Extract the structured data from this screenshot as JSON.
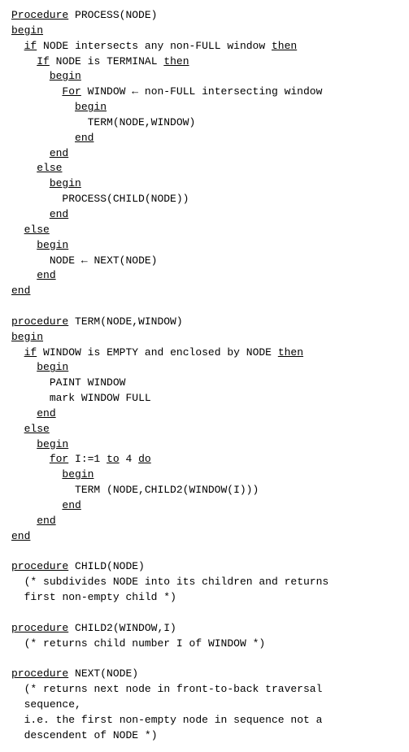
{
  "code": {
    "lines": [
      {
        "id": 1,
        "text": "Procedure PROCESS(NODE)",
        "underline_words": [
          "Procedure"
        ]
      },
      {
        "id": 2,
        "text": "begin",
        "underline_words": [
          "begin"
        ]
      },
      {
        "id": 3,
        "text": "  if NODE intersects any non-FULL window then",
        "underline_words": [
          "if",
          "then"
        ]
      },
      {
        "id": 4,
        "text": "    If NODE is TERMINAL then",
        "underline_words": [
          "If"
        ]
      },
      {
        "id": 5,
        "text": "      begin",
        "underline_words": [
          "begin"
        ]
      },
      {
        "id": 6,
        "text": "        For WINDOW ← non-FULL intersecting window",
        "underline_words": [
          "For"
        ]
      },
      {
        "id": 7,
        "text": "          begin",
        "underline_words": [
          "begin"
        ]
      },
      {
        "id": 8,
        "text": "            TERM(NODE,WINDOW)",
        "underline_words": []
      },
      {
        "id": 9,
        "text": "          end",
        "underline_words": [
          "end"
        ]
      },
      {
        "id": 10,
        "text": "      end",
        "underline_words": [
          "end"
        ]
      },
      {
        "id": 11,
        "text": "    else",
        "underline_words": [
          "else"
        ]
      },
      {
        "id": 12,
        "text": "      begin",
        "underline_words": [
          "begin"
        ]
      },
      {
        "id": 13,
        "text": "        PROCESS(CHILD(NODE))",
        "underline_words": []
      },
      {
        "id": 14,
        "text": "      end",
        "underline_words": [
          "end"
        ]
      },
      {
        "id": 15,
        "text": "  else",
        "underline_words": [
          "else"
        ]
      },
      {
        "id": 16,
        "text": "    begin",
        "underline_words": [
          "begin"
        ]
      },
      {
        "id": 17,
        "text": "      NODE ← NEXT(NODE)",
        "underline_words": []
      },
      {
        "id": 18,
        "text": "    end",
        "underline_words": [
          "end"
        ]
      },
      {
        "id": 19,
        "text": "end",
        "underline_words": [
          "end"
        ]
      },
      {
        "id": 20,
        "text": "",
        "underline_words": []
      },
      {
        "id": 21,
        "text": "procedure TERM(NODE,WINDOW)",
        "underline_words": [
          "procedure"
        ]
      },
      {
        "id": 22,
        "text": "begin",
        "underline_words": [
          "begin"
        ]
      },
      {
        "id": 23,
        "text": "  if WINDOW is EMPTY and enclosed by NODE then",
        "underline_words": [
          "if",
          "then"
        ]
      },
      {
        "id": 24,
        "text": "    begin",
        "underline_words": [
          "begin"
        ]
      },
      {
        "id": 25,
        "text": "      PAINT WINDOW",
        "underline_words": []
      },
      {
        "id": 26,
        "text": "      mark WINDOW FULL",
        "underline_words": []
      },
      {
        "id": 27,
        "text": "    end",
        "underline_words": [
          "end"
        ]
      },
      {
        "id": 28,
        "text": "  else",
        "underline_words": [
          "else"
        ]
      },
      {
        "id": 29,
        "text": "    begin",
        "underline_words": [
          "begin"
        ]
      },
      {
        "id": 30,
        "text": "      for I:=1 to 4 do",
        "underline_words": [
          "for",
          "to",
          "do"
        ]
      },
      {
        "id": 31,
        "text": "        begin",
        "underline_words": [
          "begin"
        ]
      },
      {
        "id": 32,
        "text": "          TERM (NODE,CHILD2(WINDOW(I)))",
        "underline_words": []
      },
      {
        "id": 33,
        "text": "        end",
        "underline_words": [
          "end"
        ]
      },
      {
        "id": 34,
        "text": "    end",
        "underline_words": [
          "end"
        ]
      },
      {
        "id": 35,
        "text": "end",
        "underline_words": [
          "end"
        ]
      },
      {
        "id": 36,
        "text": "",
        "underline_words": []
      },
      {
        "id": 37,
        "text": "procedure CHILD(NODE)",
        "underline_words": [
          "procedure"
        ]
      },
      {
        "id": 38,
        "text": "  (* subdivides NODE into its children and returns",
        "underline_words": []
      },
      {
        "id": 39,
        "text": "  first non-empty child *)",
        "underline_words": []
      },
      {
        "id": 40,
        "text": "",
        "underline_words": []
      },
      {
        "id": 41,
        "text": "procedure CHILD2(WINDOW,I)",
        "underline_words": [
          "procedure"
        ]
      },
      {
        "id": 42,
        "text": "  (* returns child number I of WINDOW *)",
        "underline_words": []
      },
      {
        "id": 43,
        "text": "",
        "underline_words": []
      },
      {
        "id": 44,
        "text": "procedure NEXT(NODE)",
        "underline_words": [
          "procedure"
        ]
      },
      {
        "id": 45,
        "text": "  (* returns next node in front-to-back traversal",
        "underline_words": []
      },
      {
        "id": 46,
        "text": "  sequence,",
        "underline_words": []
      },
      {
        "id": 47,
        "text": "  i.e. the first non-empty node in sequence not a",
        "underline_words": []
      },
      {
        "id": 48,
        "text": "  descendent of NODE *)",
        "underline_words": []
      }
    ]
  }
}
